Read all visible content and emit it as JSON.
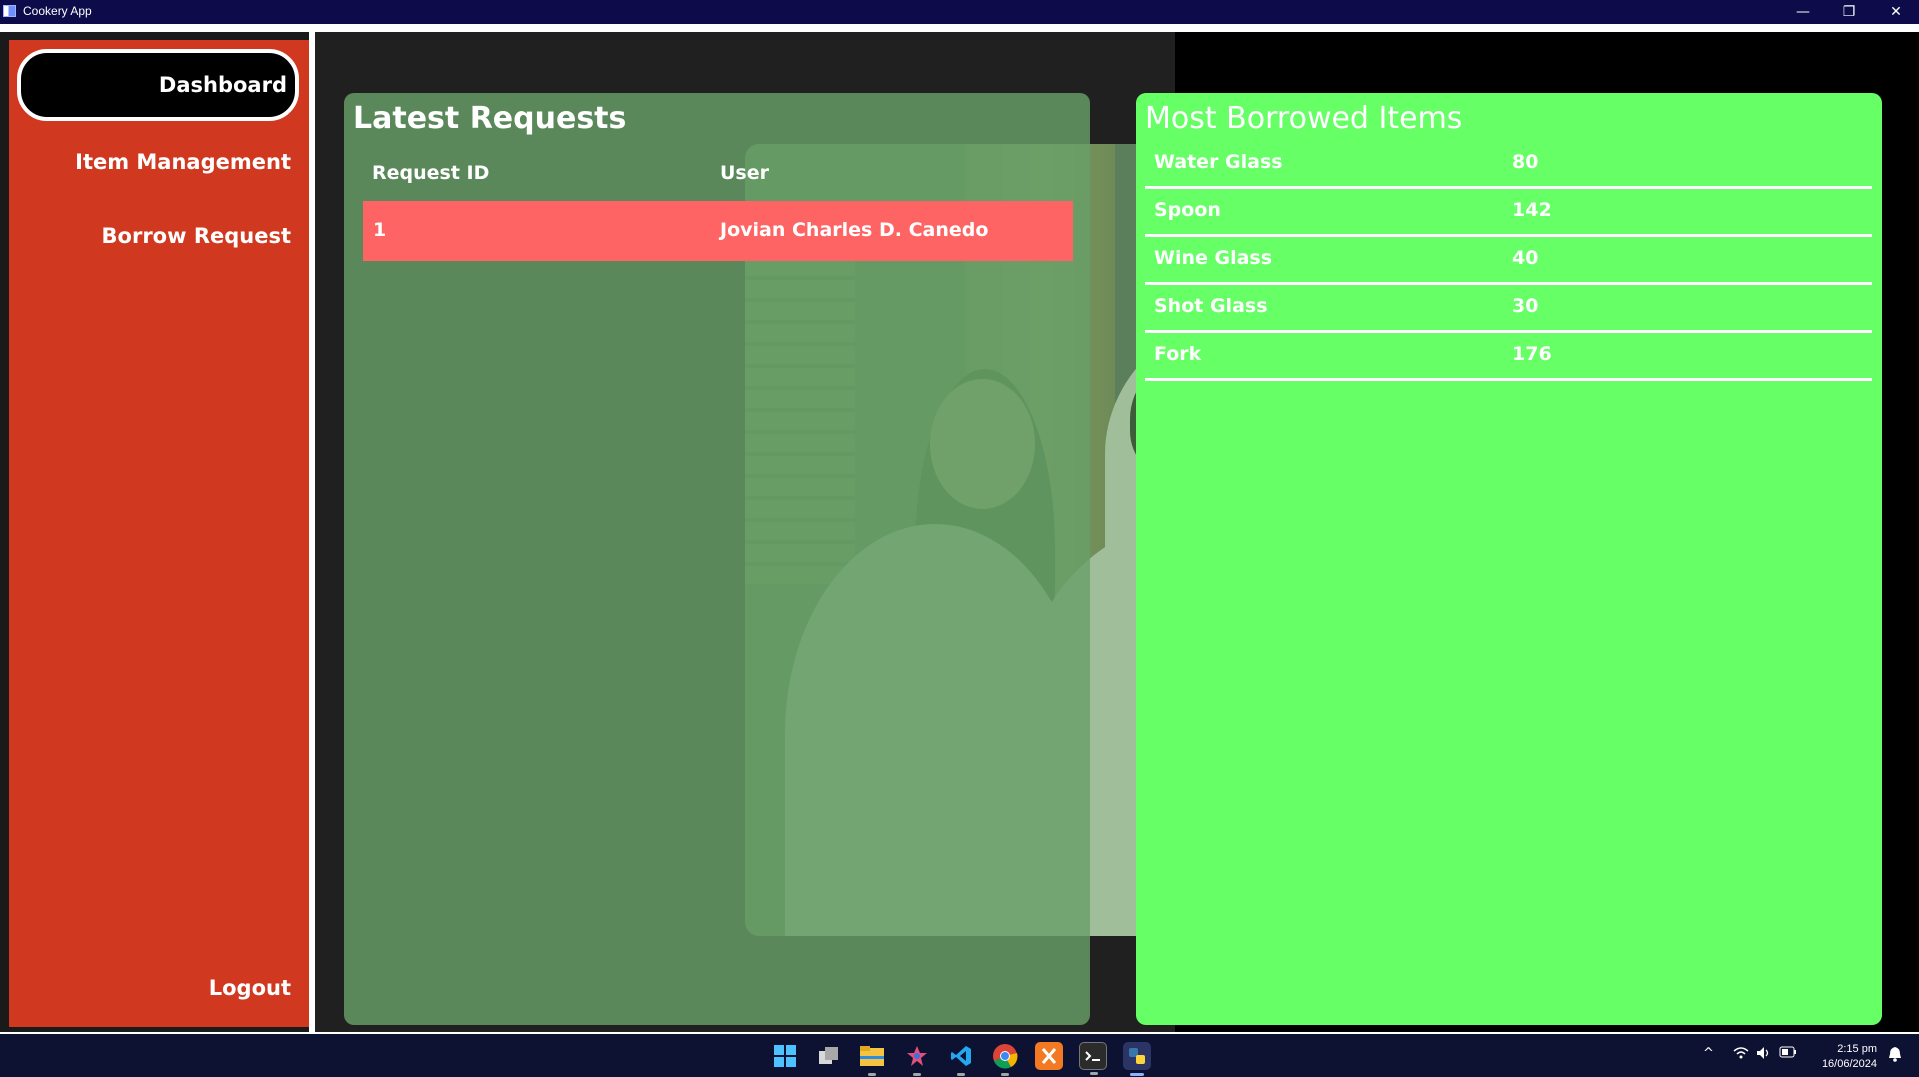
{
  "window": {
    "title": "Cookery App",
    "minimize_glyph": "—",
    "restore_glyph": "❐",
    "close_glyph": "✕"
  },
  "sidebar": {
    "items": [
      {
        "label": "Dashboard",
        "active": true
      },
      {
        "label": "Item Management",
        "active": false
      },
      {
        "label": "Borrow Request",
        "active": false
      }
    ],
    "logout_label": "Logout"
  },
  "latest_requests": {
    "title": "Latest Requests",
    "columns": [
      "Request ID",
      "User"
    ],
    "rows": [
      {
        "id": "1",
        "user": "Jovian Charles D. Canedo"
      }
    ]
  },
  "most_borrowed": {
    "title": "Most Borrowed Items",
    "rows": [
      {
        "name": "Water Glass",
        "count": "80"
      },
      {
        "name": "Spoon",
        "count": "142"
      },
      {
        "name": "Wine Glass",
        "count": "40"
      },
      {
        "name": "Shot Glass",
        "count": "30"
      },
      {
        "name": "Fork",
        "count": "176"
      }
    ]
  },
  "taskbar": {
    "time": "2:15 pm",
    "date": "16/06/2024",
    "icons": [
      "windows-start-icon",
      "task-view-icon",
      "file-explorer-icon",
      "paint-icon",
      "vscode-icon",
      "chrome-icon",
      "xampp-icon",
      "terminal-icon",
      "python-app-icon"
    ]
  },
  "colors": {
    "sidebar": "#d0391f",
    "left_panel": "#68a068",
    "right_panel": "#66ff66",
    "request_row": "#ff6464",
    "titlebar": "#0d0b49",
    "taskbar": "#0e1232"
  }
}
